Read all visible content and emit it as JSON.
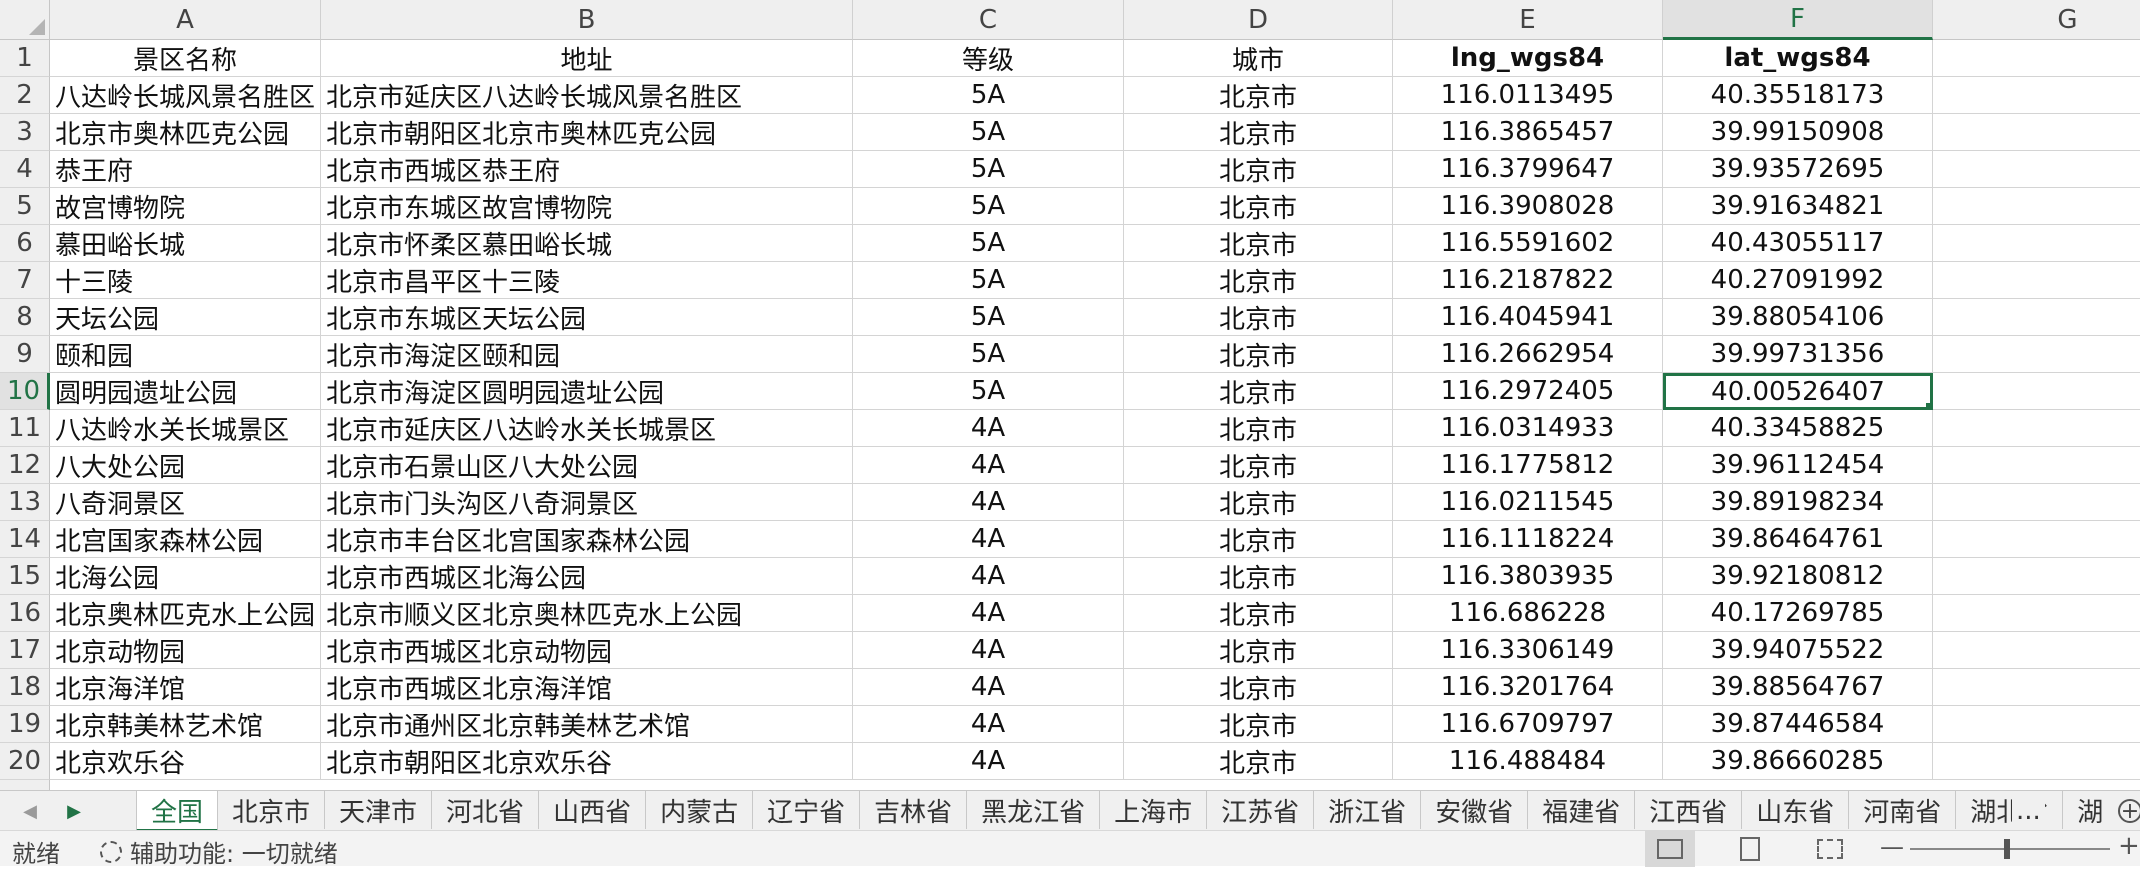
{
  "columns": [
    "A",
    "B",
    "C",
    "D",
    "E",
    "F",
    "G"
  ],
  "selected_column": "F",
  "selected_row": "10",
  "header_row": {
    "num": "1",
    "cells": [
      "景区名称",
      "地址",
      "等级",
      "城市",
      "lng_wgs84",
      "lat_wgs84",
      ""
    ]
  },
  "rows": [
    {
      "num": "2",
      "cells": [
        "八达岭长城风景名胜区",
        "北京市延庆区八达岭长城风景名胜区",
        "5A",
        "北京市",
        "116.0113495",
        "40.35518173",
        ""
      ]
    },
    {
      "num": "3",
      "cells": [
        "北京市奥林匹克公园",
        "北京市朝阳区北京市奥林匹克公园",
        "5A",
        "北京市",
        "116.3865457",
        "39.99150908",
        ""
      ]
    },
    {
      "num": "4",
      "cells": [
        "恭王府",
        "北京市西城区恭王府",
        "5A",
        "北京市",
        "116.3799647",
        "39.93572695",
        ""
      ]
    },
    {
      "num": "5",
      "cells": [
        "故宫博物院",
        "北京市东城区故宫博物院",
        "5A",
        "北京市",
        "116.3908028",
        "39.91634821",
        ""
      ]
    },
    {
      "num": "6",
      "cells": [
        "慕田峪长城",
        "北京市怀柔区慕田峪长城",
        "5A",
        "北京市",
        "116.5591602",
        "40.43055117",
        ""
      ]
    },
    {
      "num": "7",
      "cells": [
        "十三陵",
        "北京市昌平区十三陵",
        "5A",
        "北京市",
        "116.2187822",
        "40.27091992",
        ""
      ]
    },
    {
      "num": "8",
      "cells": [
        "天坛公园",
        "北京市东城区天坛公园",
        "5A",
        "北京市",
        "116.4045941",
        "39.88054106",
        ""
      ]
    },
    {
      "num": "9",
      "cells": [
        "颐和园",
        "北京市海淀区颐和园",
        "5A",
        "北京市",
        "116.2662954",
        "39.99731356",
        ""
      ]
    },
    {
      "num": "10",
      "cells": [
        "圆明园遗址公园",
        "北京市海淀区圆明园遗址公园",
        "5A",
        "北京市",
        "116.2972405",
        "40.00526407",
        ""
      ]
    },
    {
      "num": "11",
      "cells": [
        "八达岭水关长城景区",
        "北京市延庆区八达岭水关长城景区",
        "4A",
        "北京市",
        "116.0314933",
        "40.33458825",
        ""
      ]
    },
    {
      "num": "12",
      "cells": [
        "八大处公园",
        "北京市石景山区八大处公园",
        "4A",
        "北京市",
        "116.1775812",
        "39.96112454",
        ""
      ]
    },
    {
      "num": "13",
      "cells": [
        "八奇洞景区",
        "北京市门头沟区八奇洞景区",
        "4A",
        "北京市",
        "116.0211545",
        "39.89198234",
        ""
      ]
    },
    {
      "num": "14",
      "cells": [
        "北宫国家森林公园",
        "北京市丰台区北宫国家森林公园",
        "4A",
        "北京市",
        "116.1118224",
        "39.86464761",
        ""
      ]
    },
    {
      "num": "15",
      "cells": [
        "北海公园",
        "北京市西城区北海公园",
        "4A",
        "北京市",
        "116.3803935",
        "39.92180812",
        ""
      ]
    },
    {
      "num": "16",
      "cells": [
        "北京奥林匹克水上公园",
        "北京市顺义区北京奥林匹克水上公园",
        "4A",
        "北京市",
        "116.686228",
        "40.17269785",
        ""
      ]
    },
    {
      "num": "17",
      "cells": [
        "北京动物园",
        "北京市西城区北京动物园",
        "4A",
        "北京市",
        "116.3306149",
        "39.94075522",
        ""
      ]
    },
    {
      "num": "18",
      "cells": [
        "北京海洋馆",
        "北京市西城区北京海洋馆",
        "4A",
        "北京市",
        "116.3201764",
        "39.88564767",
        ""
      ]
    },
    {
      "num": "19",
      "cells": [
        "北京韩美林艺术馆",
        "北京市通州区北京韩美林艺术馆",
        "4A",
        "北京市",
        "116.6709797",
        "39.87446584",
        ""
      ]
    },
    {
      "num": "20",
      "cells": [
        "北京欢乐谷",
        "北京市朝阳区北京欢乐谷",
        "4A",
        "北京市",
        "116.488484",
        "39.86660285",
        ""
      ]
    }
  ],
  "sheet_tabs": [
    "全国",
    "北京市",
    "天津市",
    "河北省",
    "山西省",
    "内蒙古",
    "辽宁省",
    "吉林省",
    "黑龙江省",
    "上海市",
    "江苏省",
    "浙江省",
    "安徽省",
    "福建省",
    "江西省",
    "山东省",
    "河南省",
    "湖北省",
    "湖"
  ],
  "active_tab": "全国",
  "more_tabs_label": "...",
  "status": {
    "ready": "就绪",
    "accessibility": "辅助功能: 一切就绪"
  },
  "icons": {
    "prev_sheet": "triangle-left-icon",
    "next_sheet": "triangle-right-icon",
    "add_sheet": "plus-circle-icon",
    "accessibility": "accessibility-icon"
  },
  "colors": {
    "accent": "#217346"
  }
}
